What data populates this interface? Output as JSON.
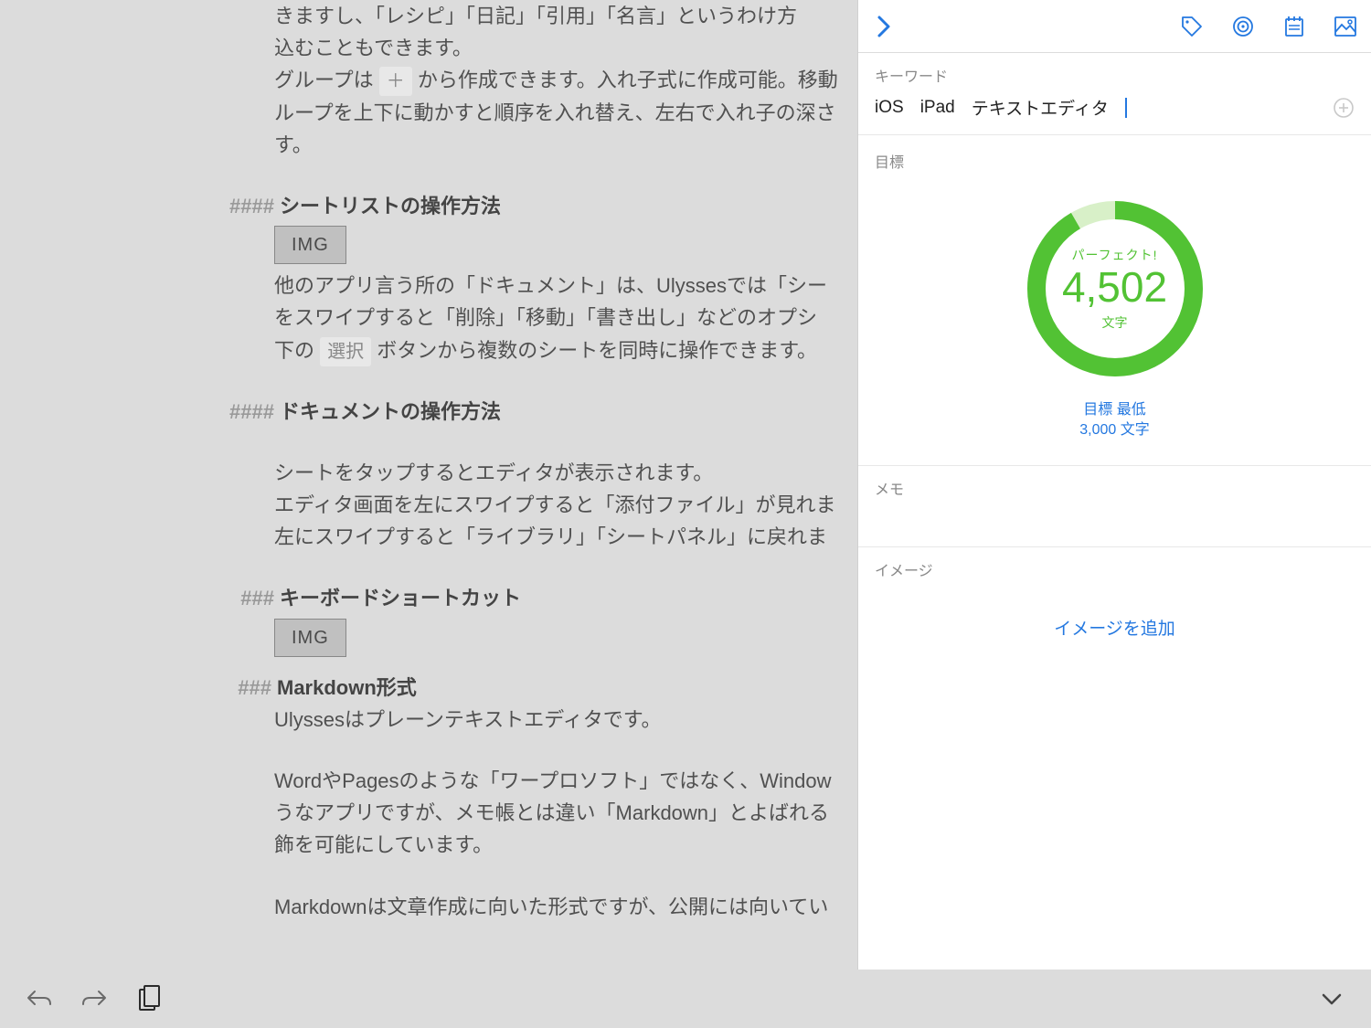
{
  "editor": {
    "para1_l1": "きますし、「レシピ」「日記」「引用」「名言」というわけ方",
    "para1_l2": "込むこともできます。",
    "para2_l1_pre": "グループは ",
    "para2_l1_badge": "＋",
    "para2_l1_post": " から作成できます。入れ子式に作成可能。移動",
    "para2_l2": "ループを上下に動かすと順序を入れ替え、左右で入れ子の深さ",
    "para2_l3": "す。",
    "h4_1_marker": "####",
    "h4_1_text": "シートリストの操作方法",
    "img_label": "IMG",
    "para3_l1": "他のアプリ言う所の「ドキュメント」は、Ulyssesでは「シー",
    "para3_l2": "をスワイプすると「削除」「移動」「書き出し」などのオプシ",
    "para3_l3_pre": "下の ",
    "para3_l3_badge": "選択",
    "para3_l3_post": " ボタンから複数のシートを同時に操作できます。",
    "h4_2_marker": "####",
    "h4_2_text": "ドキュメントの操作方法",
    "para4_l1": "シートをタップするとエディタが表示されます。",
    "para4_l2": "エディタ画面を左にスワイプすると「添付ファイル」が見れま",
    "para4_l3": "左にスワイプすると「ライブラリ」「シートパネル」に戻れま",
    "h3_1_marker": "###",
    "h3_1_text": "キーボードショートカット",
    "h3_2_marker": "###",
    "h3_2_text": "Markdown形式",
    "para5_l1": "Ulyssesはプレーンテキストエディタです。",
    "para6_l1": "WordやPagesのような「ワープロソフト」ではなく、Window",
    "para6_l2": "うなアプリですが、メモ帳とは違い「Markdown」とよばれる",
    "para6_l3": "飾を可能にしています。",
    "para7_l1": "Markdownは文章作成に向いた形式ですが、公開には向いてい"
  },
  "inspector": {
    "keyword_label": "キーワード",
    "keywords": [
      "iOS",
      "iPad",
      "テキストエディタ"
    ],
    "goal_label": "目標",
    "perfect": "パーフェクト!",
    "count": "4,502",
    "unit": "文字",
    "goal_footer_1": "目標 最低",
    "goal_footer_2": "3,000 文字",
    "memo_label": "メモ",
    "image_label": "イメージ",
    "add_image": "イメージを追加"
  },
  "colors": {
    "accent_blue": "#2478e0",
    "accent_green": "#52c234"
  }
}
